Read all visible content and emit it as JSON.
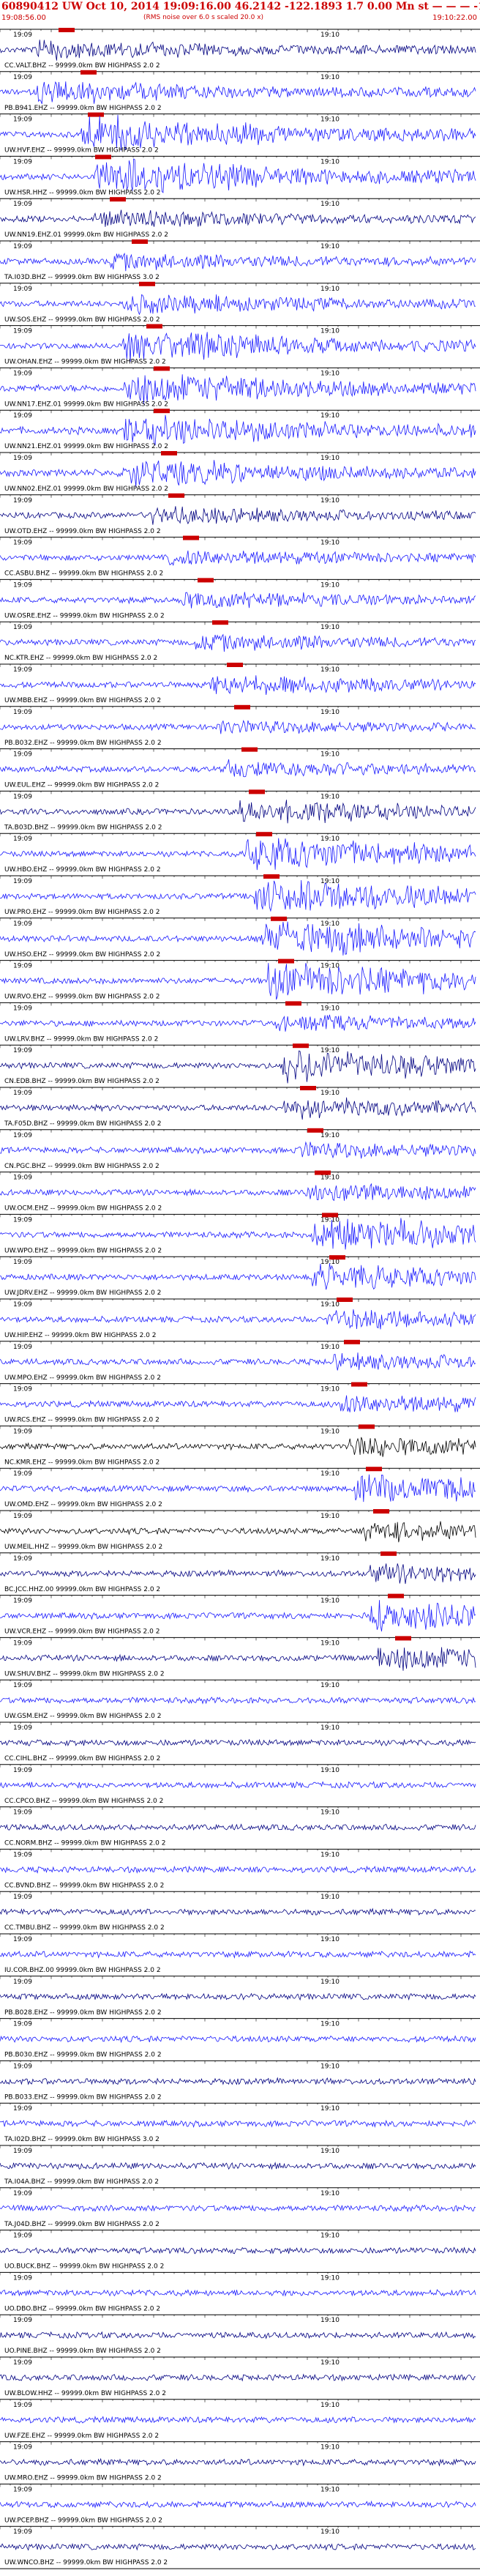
{
  "header": {
    "title": "60890412 UW Oct 10, 2014 19:09:16.00    46.2142  -122.1893   1.7 0.00 Mn st — — — -1",
    "start_time": "19:08:56.00",
    "note": "(RMS noise over 6.0 s scaled 20.0 x)",
    "end_time": "19:10:22.00"
  },
  "chart_data": {
    "type": "line",
    "tick_labels": [
      "19:09",
      "19:10"
    ],
    "traces": [
      {
        "label": "CC.VALT.BHZ -- 99999.0km BW  HIGHPASS  2.0  2",
        "color": "#000080",
        "amp": 0.25,
        "pick": 0.53,
        "burst": [
          0.5,
          0.75,
          0.5
        ]
      },
      {
        "label": "PB.B941.EHZ -- 99999.0km BW  HIGHPASS  2.0  2",
        "color": "#1a1aff",
        "amp": 0.2,
        "pick": 0.56,
        "burst": [
          0.5,
          0.62,
          0.6
        ]
      },
      {
        "label": "UW.HVF.EHZ -- 99999.0km BW  HIGHPASS  2.0  2",
        "color": "#1a1aff",
        "amp": 0.3,
        "pick": 0.57,
        "burst": [
          0.56,
          0.66,
          1.0
        ]
      },
      {
        "label": "UW.HSR.HHZ -- 99999.0km BW  HIGHPASS  2.0  2",
        "color": "#1a1aff",
        "amp": 0.3,
        "pick": 0.58,
        "burst": [
          0.58,
          1.0,
          1.0
        ]
      },
      {
        "label": "UW.NN19.EHZ.01 99999.0km BW  HIGHPASS  2.0  2",
        "color": "#000080",
        "amp": 0.3,
        "pick": 0.6,
        "burst": [
          0.58,
          0.9,
          0.4
        ]
      },
      {
        "label": "TA.I03D.BHZ -- 99999.0km BW  HIGHPASS  3.0  2",
        "color": "#1a1aff",
        "amp": 0.3,
        "pick": 0.63,
        "burst": [
          0.6,
          0.7,
          0.4
        ]
      },
      {
        "label": "UW.SOS.EHZ -- 99999.0km BW  HIGHPASS  2.0  2",
        "color": "#1a1aff",
        "amp": 0.3,
        "pick": 0.64,
        "burst": [
          0.62,
          0.9,
          0.5
        ]
      },
      {
        "label": "UW.OHAN.EHZ -- 99999.0km BW  HIGHPASS  2.0  2",
        "color": "#1a1aff",
        "amp": 0.3,
        "pick": 0.65,
        "burst": [
          0.62,
          1.0,
          0.8
        ]
      },
      {
        "label": "UW.NN17.EHZ.01 99999.0km BW  HIGHPASS  2.0  2",
        "color": "#1a1aff",
        "amp": 0.5,
        "pick": 0.66,
        "burst": [
          0.62,
          1.0,
          0.9
        ]
      },
      {
        "label": "UW.NN21.EHZ.01 99999.0km BW  HIGHPASS  2.0  2",
        "color": "#1a1aff",
        "amp": 0.5,
        "pick": 0.66,
        "burst": [
          0.62,
          1.0,
          0.8
        ]
      },
      {
        "label": "UW.NN02.EHZ.01 99999.0km BW  HIGHPASS  2.0  2",
        "color": "#1a1aff",
        "amp": 0.5,
        "pick": 0.67,
        "burst": [
          0.62,
          1.0,
          0.7
        ]
      },
      {
        "label": "UW.OTD.EHZ -- 99999.0km BW  HIGHPASS  2.0  2",
        "color": "#000080",
        "amp": 0.3,
        "pick": 0.68,
        "burst": [
          0.66,
          0.85,
          0.4
        ]
      },
      {
        "label": "CC.ASBU.BHZ -- 99999.0km BW  HIGHPASS  2.0  2",
        "color": "#1a1aff",
        "amp": 0.25,
        "pick": 0.7,
        "burst": [
          0.68,
          0.9,
          0.4
        ]
      },
      {
        "label": "UW.OSRE.EHZ -- 99999.0km BW  HIGHPASS  2.0  2",
        "color": "#1a1aff",
        "amp": 0.3,
        "pick": 0.72,
        "burst": [
          0.7,
          0.8,
          0.4
        ]
      },
      {
        "label": "NC.KTR.EHZ -- 99999.0km BW  HIGHPASS  2.0  2",
        "color": "#1a1aff",
        "amp": 0.3,
        "pick": 0.74,
        "burst": [
          0.72,
          0.82,
          0.4
        ]
      },
      {
        "label": "UW.MBB.EHZ -- 99999.0km BW  HIGHPASS  2.0  2",
        "color": "#1a1aff",
        "amp": 0.3,
        "pick": 0.76,
        "burst": [
          0.74,
          0.9,
          0.5
        ]
      },
      {
        "label": "PB.B032.EHZ -- 99999.0km BW  HIGHPASS  2.0  2",
        "color": "#1a1aff",
        "amp": 0.25,
        "pick": 0.77,
        "burst": [
          0.75,
          0.85,
          0.3
        ]
      },
      {
        "label": "UW.EUL.EHZ -- 99999.0km BW  HIGHPASS  2.0  2",
        "color": "#1a1aff",
        "amp": 0.3,
        "pick": 0.78,
        "burst": [
          0.76,
          0.9,
          0.4
        ]
      },
      {
        "label": "TA.B03D.BHZ -- 99999.0km BW  HIGHPASS  2.0  2",
        "color": "#000080",
        "amp": 0.3,
        "pick": 0.79,
        "burst": [
          0.78,
          0.95,
          0.6
        ]
      },
      {
        "label": "UW.HBO.EHZ -- 99999.0km BW  HIGHPASS  2.0  2",
        "color": "#1a1aff",
        "amp": 0.25,
        "pick": 0.8,
        "burst": [
          0.79,
          0.82,
          1.0
        ]
      },
      {
        "label": "UW.PRO.EHZ -- 99999.0km BW  HIGHPASS  2.0  2",
        "color": "#1a1aff",
        "amp": 0.25,
        "pick": 0.81,
        "burst": [
          0.8,
          0.84,
          1.0
        ]
      },
      {
        "label": "UW.HSO.EHZ -- 99999.0km BW  HIGHPASS  2.0  2",
        "color": "#1a1aff",
        "amp": 0.3,
        "pick": 0.82,
        "burst": [
          0.81,
          0.85,
          1.0
        ]
      },
      {
        "label": "UW.RVO.EHZ -- 99999.0km BW  HIGHPASS  2.0  2",
        "color": "#1a1aff",
        "amp": 0.3,
        "pick": 0.83,
        "burst": [
          0.82,
          0.86,
          1.0
        ]
      },
      {
        "label": "UW.LRV.BHZ -- 99999.0km BW  HIGHPASS  2.0  2",
        "color": "#1a1aff",
        "amp": 0.3,
        "pick": 0.84,
        "burst": [
          0.83,
          0.9,
          0.4
        ]
      },
      {
        "label": "CN.EDB.BHZ -- 99999.0km BW  HIGHPASS  2.0  2",
        "color": "#000080",
        "amp": 0.3,
        "pick": 0.85,
        "burst": [
          0.84,
          1.0,
          0.9
        ]
      },
      {
        "label": "TA.F05D.BHZ -- 99999.0km BW  HIGHPASS  2.0  2",
        "color": "#000080",
        "amp": 0.3,
        "pick": 0.86,
        "burst": [
          0.84,
          1.0,
          0.5
        ]
      },
      {
        "label": "CN.PGC.BHZ -- 99999.0km BW  HIGHPASS  2.0  2",
        "color": "#1a1aff",
        "amp": 0.3,
        "pick": 0.87,
        "burst": [
          0.86,
          1.0,
          0.4
        ]
      },
      {
        "label": "UW.OCM.EHZ -- 99999.0km BW  HIGHPASS  2.0  2",
        "color": "#1a1aff",
        "amp": 0.25,
        "pick": 0.88,
        "burst": [
          0.87,
          1.0,
          0.5
        ]
      },
      {
        "label": "UW.WPO.EHZ -- 99999.0km BW  HIGHPASS  2.0  2",
        "color": "#1a1aff",
        "amp": 0.3,
        "pick": 0.89,
        "burst": [
          0.88,
          1.0,
          1.0
        ]
      },
      {
        "label": "UW.JDRV.EHZ -- 99999.0km BW  HIGHPASS  2.0  2",
        "color": "#1a1aff",
        "amp": 0.3,
        "pick": 0.9,
        "burst": [
          0.88,
          1.0,
          0.7
        ]
      },
      {
        "label": "UW.HIP.EHZ -- 99999.0km BW  HIGHPASS  2.0  2",
        "color": "#1a1aff",
        "amp": 0.3,
        "pick": 0.91,
        "burst": [
          0.9,
          0.95,
          0.5
        ]
      },
      {
        "label": "UW.MPO.EHZ -- 99999.0km BW  HIGHPASS  2.0  2",
        "color": "#1a1aff",
        "amp": 0.3,
        "pick": 0.92,
        "burst": [
          0.91,
          0.98,
          0.4
        ]
      },
      {
        "label": "UW.RCS.EHZ -- 99999.0km BW  HIGHPASS  2.0  2",
        "color": "#1a1aff",
        "amp": 0.3,
        "pick": 0.93,
        "burst": [
          0.92,
          1.0,
          0.5
        ]
      },
      {
        "label": "NC.KMR.EHZ -- 99999.0km BW  HIGHPASS  2.0  2",
        "color": "#000000",
        "amp": 0.3,
        "pick": 0.94,
        "burst": [
          0.93,
          1.0,
          0.5
        ]
      },
      {
        "label": "UW.OMD.EHZ -- 99999.0km BW  HIGHPASS  2.0  2",
        "color": "#1a1aff",
        "amp": 0.3,
        "pick": 0.95,
        "burst": [
          0.94,
          1.0,
          0.8
        ]
      },
      {
        "label": "UW.MEIL.HHZ -- 99999.0km BW  HIGHPASS  2.0  2",
        "color": "#000000",
        "amp": 0.3,
        "pick": 0.96,
        "burst": [
          0.95,
          1.0,
          0.5
        ]
      },
      {
        "label": "BC.JCC.HHZ.00 99999.0km BW  HIGHPASS  2.0  2",
        "color": "#000080",
        "amp": 0.3,
        "pick": 0.97,
        "burst": [
          0.96,
          1.0,
          0.5
        ]
      },
      {
        "label": "UW.VCR.EHZ -- 99999.0km BW  HIGHPASS  2.0  2",
        "color": "#1a1aff",
        "amp": 0.3,
        "pick": 0.98,
        "burst": [
          0.96,
          1.0,
          0.8
        ]
      },
      {
        "label": "UW.SHUV.BHZ -- 99999.0km BW  HIGHPASS  2.0  2",
        "color": "#000080",
        "amp": 0.3,
        "pick": 0.99,
        "burst": [
          0.97,
          1.0,
          0.7
        ]
      },
      {
        "label": "UW.GSM.EHZ -- 99999.0km BW  HIGHPASS  2.0  2",
        "color": "#1a1aff",
        "amp": 0.3,
        "pick": null,
        "burst": null
      },
      {
        "label": "CC.CIHL.BHZ -- 99999.0km BW  HIGHPASS  2.0  2",
        "color": "#000080",
        "amp": 0.3,
        "pick": null,
        "burst": null
      },
      {
        "label": "CC.CPCO.BHZ -- 99999.0km BW  HIGHPASS  2.0  2",
        "color": "#1a1aff",
        "amp": 0.3,
        "pick": null,
        "burst": null
      },
      {
        "label": "CC.NORM.BHZ -- 99999.0km BW  HIGHPASS  2.0  2",
        "color": "#000080",
        "amp": 0.3,
        "pick": null,
        "burst": null
      },
      {
        "label": "CC.BVND.BHZ -- 99999.0km BW  HIGHPASS  2.0  2",
        "color": "#1a1aff",
        "amp": 0.3,
        "pick": null,
        "burst": null
      },
      {
        "label": "CC.TMBU.BHZ -- 99999.0km BW  HIGHPASS  2.0  2",
        "color": "#000080",
        "amp": 0.3,
        "pick": null,
        "burst": null
      },
      {
        "label": "IU.COR.BHZ.00 99999.0km BW  HIGHPASS  2.0  2",
        "color": "#1a1aff",
        "amp": 0.3,
        "pick": null,
        "burst": null
      },
      {
        "label": "PB.B028.EHZ -- 99999.0km BW  HIGHPASS  2.0  2",
        "color": "#000080",
        "amp": 0.3,
        "pick": null,
        "burst": null
      },
      {
        "label": "PB.B030.EHZ -- 99999.0km BW  HIGHPASS  2.0  2",
        "color": "#1a1aff",
        "amp": 0.3,
        "pick": null,
        "burst": null
      },
      {
        "label": "PB.B033.EHZ -- 99999.0km BW  HIGHPASS  2.0  2",
        "color": "#000080",
        "amp": 0.3,
        "pick": null,
        "burst": null
      },
      {
        "label": "TA.I02D.BHZ -- 99999.0km BW  HIGHPASS  3.0  2",
        "color": "#1a1aff",
        "amp": 0.3,
        "pick": null,
        "burst": null
      },
      {
        "label": "TA.I04A.BHZ -- 99999.0km BW  HIGHPASS  2.0  2",
        "color": "#000080",
        "amp": 0.3,
        "pick": null,
        "burst": null
      },
      {
        "label": "TA.J04D.BHZ -- 99999.0km BW  HIGHPASS  2.0  2",
        "color": "#1a1aff",
        "amp": 0.3,
        "pick": null,
        "burst": null
      },
      {
        "label": "UO.BUCK.BHZ -- 99999.0km BW  HIGHPASS  2.0  2",
        "color": "#000080",
        "amp": 0.3,
        "pick": null,
        "burst": null
      },
      {
        "label": "UO.DBO.BHZ -- 99999.0km BW  HIGHPASS  2.0  2",
        "color": "#1a1aff",
        "amp": 0.3,
        "pick": null,
        "burst": null
      },
      {
        "label": "UO.PINE.BHZ -- 99999.0km BW  HIGHPASS  2.0  2",
        "color": "#000080",
        "amp": 0.3,
        "pick": null,
        "burst": null
      },
      {
        "label": "UW.BLOW.HHZ -- 99999.0km BW  HIGHPASS  2.0  2",
        "color": "#000080",
        "amp": 0.3,
        "pick": null,
        "burst": null
      },
      {
        "label": "UW.FZE.EHZ -- 99999.0km BW  HIGHPASS  2.0  2",
        "color": "#1a1aff",
        "amp": 0.3,
        "pick": null,
        "burst": null
      },
      {
        "label": "UW.MRO.EHZ -- 99999.0km BW  HIGHPASS  2.0  2",
        "color": "#000080",
        "amp": 0.3,
        "pick": null,
        "burst": null
      },
      {
        "label": "UW.PCEP.BHZ -- 99999.0km BW  HIGHPASS  2.0  2",
        "color": "#1a1aff",
        "amp": 0.3,
        "pick": null,
        "burst": null
      },
      {
        "label": "UW.WNCO.BHZ -- 99999.0km BW  HIGHPASS  2.0  2",
        "color": "#000080",
        "amp": 0.3,
        "pick": null,
        "burst": null
      }
    ]
  }
}
